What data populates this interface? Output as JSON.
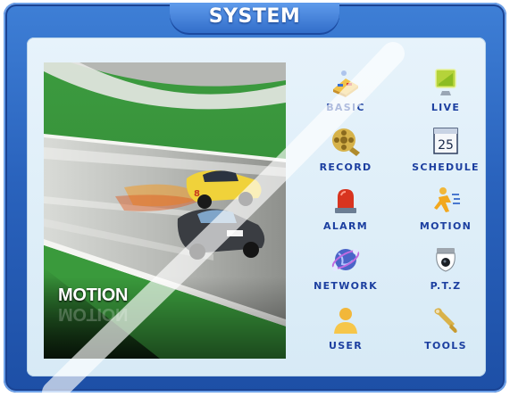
{
  "window": {
    "title": "SYSTEM"
  },
  "preview": {
    "caption": "MOTION"
  },
  "menu": {
    "items": [
      {
        "label": "BASIC",
        "icon": "basic-settings-icon"
      },
      {
        "label": "LIVE",
        "icon": "live-view-icon"
      },
      {
        "label": "RECORD",
        "icon": "film-reel-icon"
      },
      {
        "label": "SCHEDULE",
        "icon": "calendar-icon",
        "icon_text": "25"
      },
      {
        "label": "ALARM",
        "icon": "alarm-siren-icon"
      },
      {
        "label": "MOTION",
        "icon": "running-person-icon"
      },
      {
        "label": "NETWORK",
        "icon": "globe-network-icon"
      },
      {
        "label": "P.T.Z",
        "icon": "dome-camera-icon"
      },
      {
        "label": "USER",
        "icon": "user-icon"
      },
      {
        "label": "TOOLS",
        "icon": "wrench-icon"
      }
    ]
  },
  "colors": {
    "frame": "#2a63bd",
    "panel": "#e2f0f9",
    "label": "#1c3fa0"
  }
}
